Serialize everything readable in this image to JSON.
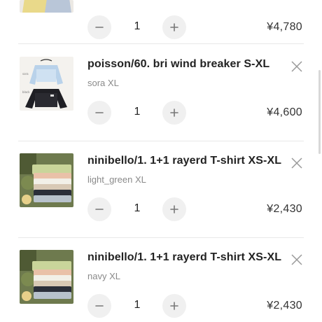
{
  "cart": {
    "items": [
      {
        "title": "",
        "variant": "",
        "quantity": "1",
        "price": "¥4,780",
        "image_icon": "skirt-thumbnail"
      },
      {
        "title": "poisson/60. bri wind breaker S-XL",
        "variant": "sora XL",
        "quantity": "1",
        "price": "¥4,600",
        "image_icon": "windbreaker-thumbnail"
      },
      {
        "title": "ninibello/1. 1+1 rayerd T-shirt XS-XL",
        "variant": "light_green XL",
        "quantity": "1",
        "price": "¥2,430",
        "image_icon": "folded-tshirts-thumbnail"
      },
      {
        "title": "ninibello/1. 1+1 rayerd T-shirt XS-XL",
        "variant": "navy XL",
        "quantity": "1",
        "price": "¥2,430",
        "image_icon": "folded-tshirts-thumbnail"
      }
    ]
  },
  "colors": {
    "text": "#222222",
    "muted": "#8a8a8a",
    "button_bg": "#f0f0f0",
    "divider": "#e8e8e8"
  }
}
